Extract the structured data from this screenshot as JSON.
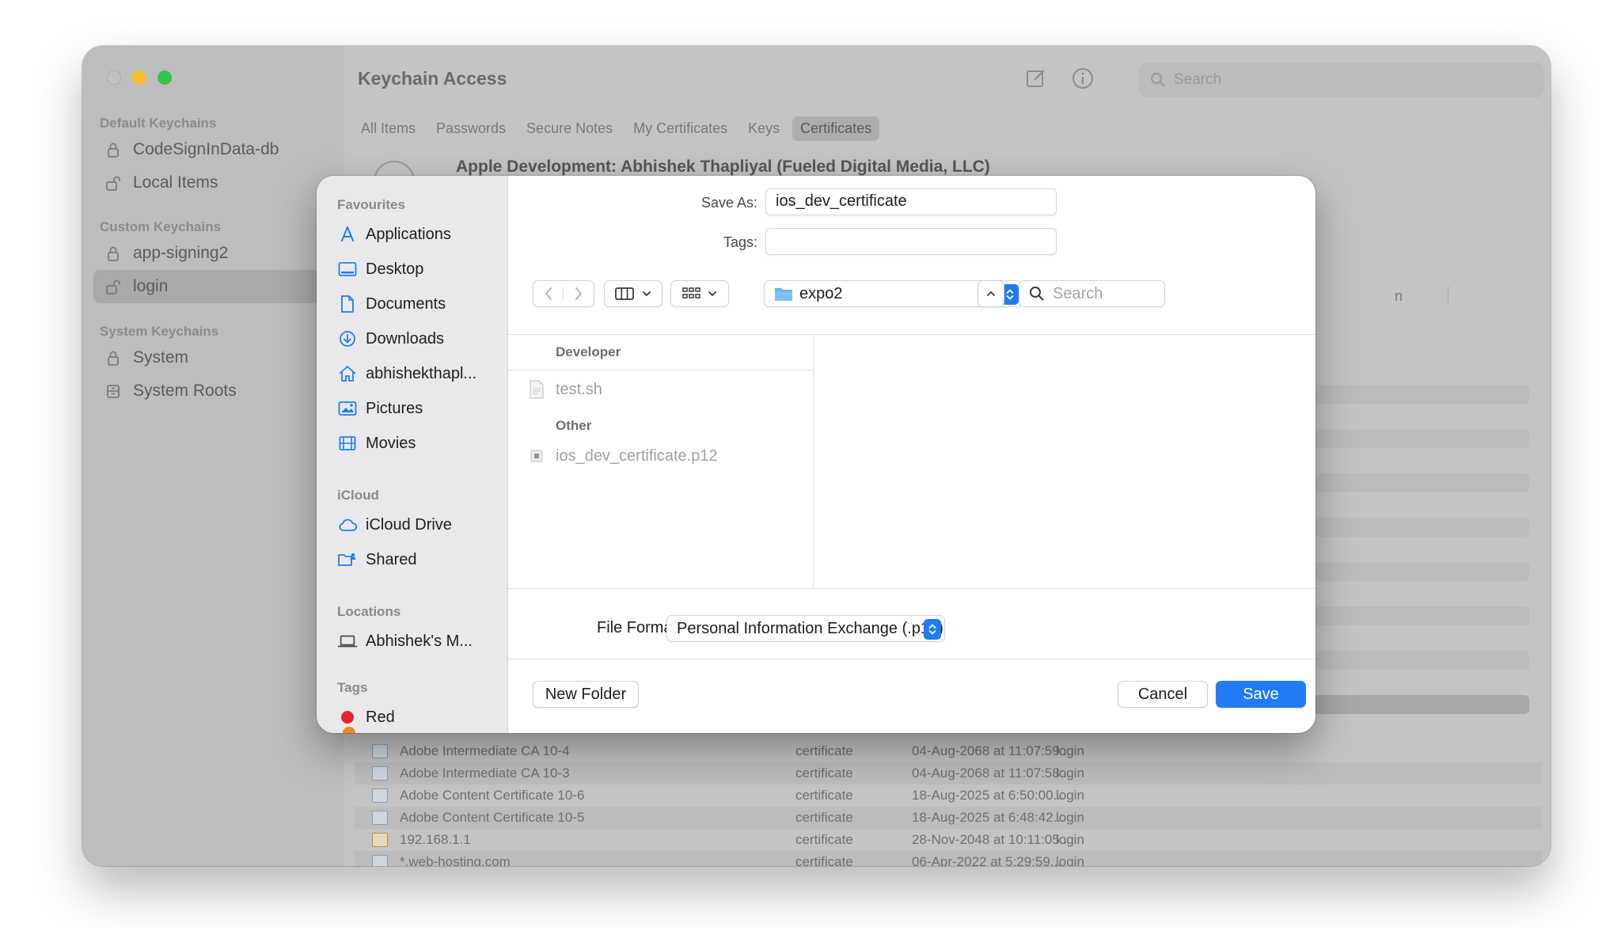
{
  "window": {
    "title": "Keychain Access",
    "search_placeholder": "Search",
    "sidebar": {
      "sections": [
        {
          "heading": "Default Keychains",
          "items": [
            {
              "label": "CodeSignInData-db",
              "icon": "lock-icon"
            },
            {
              "label": "Local Items",
              "icon": "unlock-icon"
            }
          ]
        },
        {
          "heading": "Custom Keychains",
          "items": [
            {
              "label": "app-signing2",
              "icon": "lock-icon"
            },
            {
              "label": "login",
              "icon": "unlock-icon",
              "selected": true
            }
          ]
        },
        {
          "heading": "System Keychains",
          "items": [
            {
              "label": "System",
              "icon": "lock-icon"
            },
            {
              "label": "System Roots",
              "icon": "cabinet-icon"
            }
          ]
        }
      ]
    },
    "filter_tabs": [
      "All Items",
      "Passwords",
      "Secure Notes",
      "My Certificates",
      "Keys",
      "Certificates"
    ],
    "active_filter": "Certificates",
    "selected_certificate_title": "Apple Development: Abhishek Thapliyal (Fueled Digital Media, LLC)",
    "column_fragment": "n",
    "rows": [
      {
        "name": "Adobe Intermediate CA 10-4",
        "kind": "certificate",
        "date": "04-Aug-2068 at 11:07:59...",
        "keychain": "login"
      },
      {
        "name": "Adobe Intermediate CA 10-3",
        "kind": "certificate",
        "date": "04-Aug-2068 at 11:07:58...",
        "keychain": "login"
      },
      {
        "name": "Adobe Content Certificate 10-6",
        "kind": "certificate",
        "date": "18-Aug-2025 at 6:50:00...",
        "keychain": "login"
      },
      {
        "name": "Adobe Content Certificate 10-5",
        "kind": "certificate",
        "date": "18-Aug-2025 at 6:48:42...",
        "keychain": "login"
      },
      {
        "name": "192.168.1.1",
        "kind": "certificate",
        "date": "28-Nov-2048 at 10:11:05...",
        "keychain": "login"
      },
      {
        "name": "*.web-hosting.com",
        "kind": "certificate",
        "date": "06-Apr-2022 at 5:29:59...",
        "keychain": "login"
      }
    ]
  },
  "dialog": {
    "sidebar": {
      "favourites_heading": "Favourites",
      "favourites": [
        {
          "label": "Applications",
          "icon": "applications-icon"
        },
        {
          "label": "Desktop",
          "icon": "desktop-icon"
        },
        {
          "label": "Documents",
          "icon": "documents-icon"
        },
        {
          "label": "Downloads",
          "icon": "downloads-icon"
        },
        {
          "label": "abhishekthapl...",
          "icon": "home-icon"
        },
        {
          "label": "Pictures",
          "icon": "pictures-icon"
        },
        {
          "label": "Movies",
          "icon": "movies-icon"
        }
      ],
      "icloud_heading": "iCloud",
      "icloud": [
        {
          "label": "iCloud Drive",
          "icon": "cloud-icon"
        },
        {
          "label": "Shared",
          "icon": "shared-folder-icon"
        }
      ],
      "locations_heading": "Locations",
      "locations": [
        {
          "label": "Abhishek's M...",
          "icon": "laptop-icon"
        }
      ],
      "tags_heading": "Tags",
      "tags": [
        {
          "label": "Red",
          "color": "#e8232b"
        }
      ]
    },
    "save_as_label": "Save As:",
    "save_as_value": "ios_dev_certificate",
    "tags_label": "Tags:",
    "tags_value": "",
    "location": "expo2",
    "search_placeholder": "Search",
    "groups": [
      {
        "heading": "Developer",
        "files": [
          {
            "name": "test.sh",
            "icon": "script-file-icon"
          }
        ]
      },
      {
        "heading": "Other",
        "files": [
          {
            "name": "ios_dev_certificate.p12",
            "icon": "certificate-file-icon"
          }
        ]
      }
    ],
    "file_format_label": "File Format:",
    "file_format_value": "Personal Information Exchange (.p12)",
    "new_folder_label": "New Folder",
    "cancel_label": "Cancel",
    "save_label": "Save",
    "accent_color": "#1f7cf6"
  }
}
